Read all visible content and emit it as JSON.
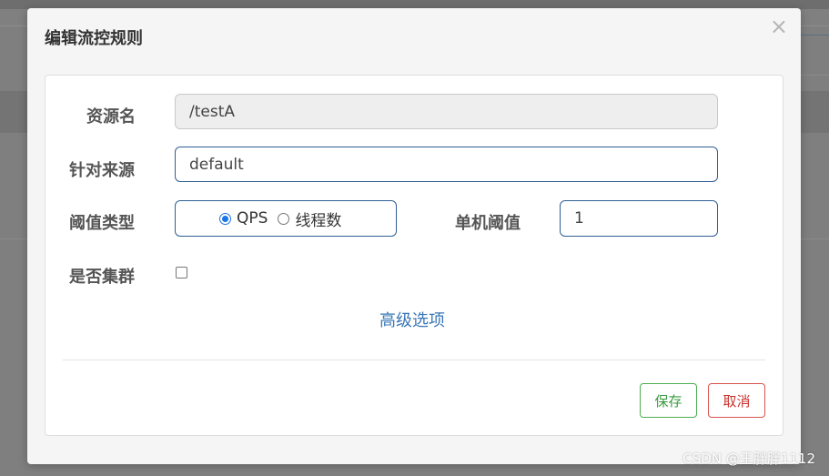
{
  "dialog": {
    "title": "编辑流控规则",
    "close_glyph": "×"
  },
  "form": {
    "resource_label": "资源名",
    "resource_value": "/testA",
    "origin_label": "针对来源",
    "origin_value": "default",
    "threshold_type_label": "阈值类型",
    "threshold_type_options": [
      "QPS",
      "线程数"
    ],
    "threshold_type_selected": "QPS",
    "single_threshold_label": "单机阈值",
    "single_threshold_value": "1",
    "cluster_label": "是否集群",
    "cluster_checked": false,
    "advanced_link": "高级选项"
  },
  "footer": {
    "save_label": "保存",
    "cancel_label": "取消"
  },
  "watermark": "CSDN @王胖胖1112",
  "colors": {
    "input_border": "#2f5f95",
    "link": "#3a77b6",
    "save": "#4caf50",
    "cancel": "#d9534f"
  }
}
